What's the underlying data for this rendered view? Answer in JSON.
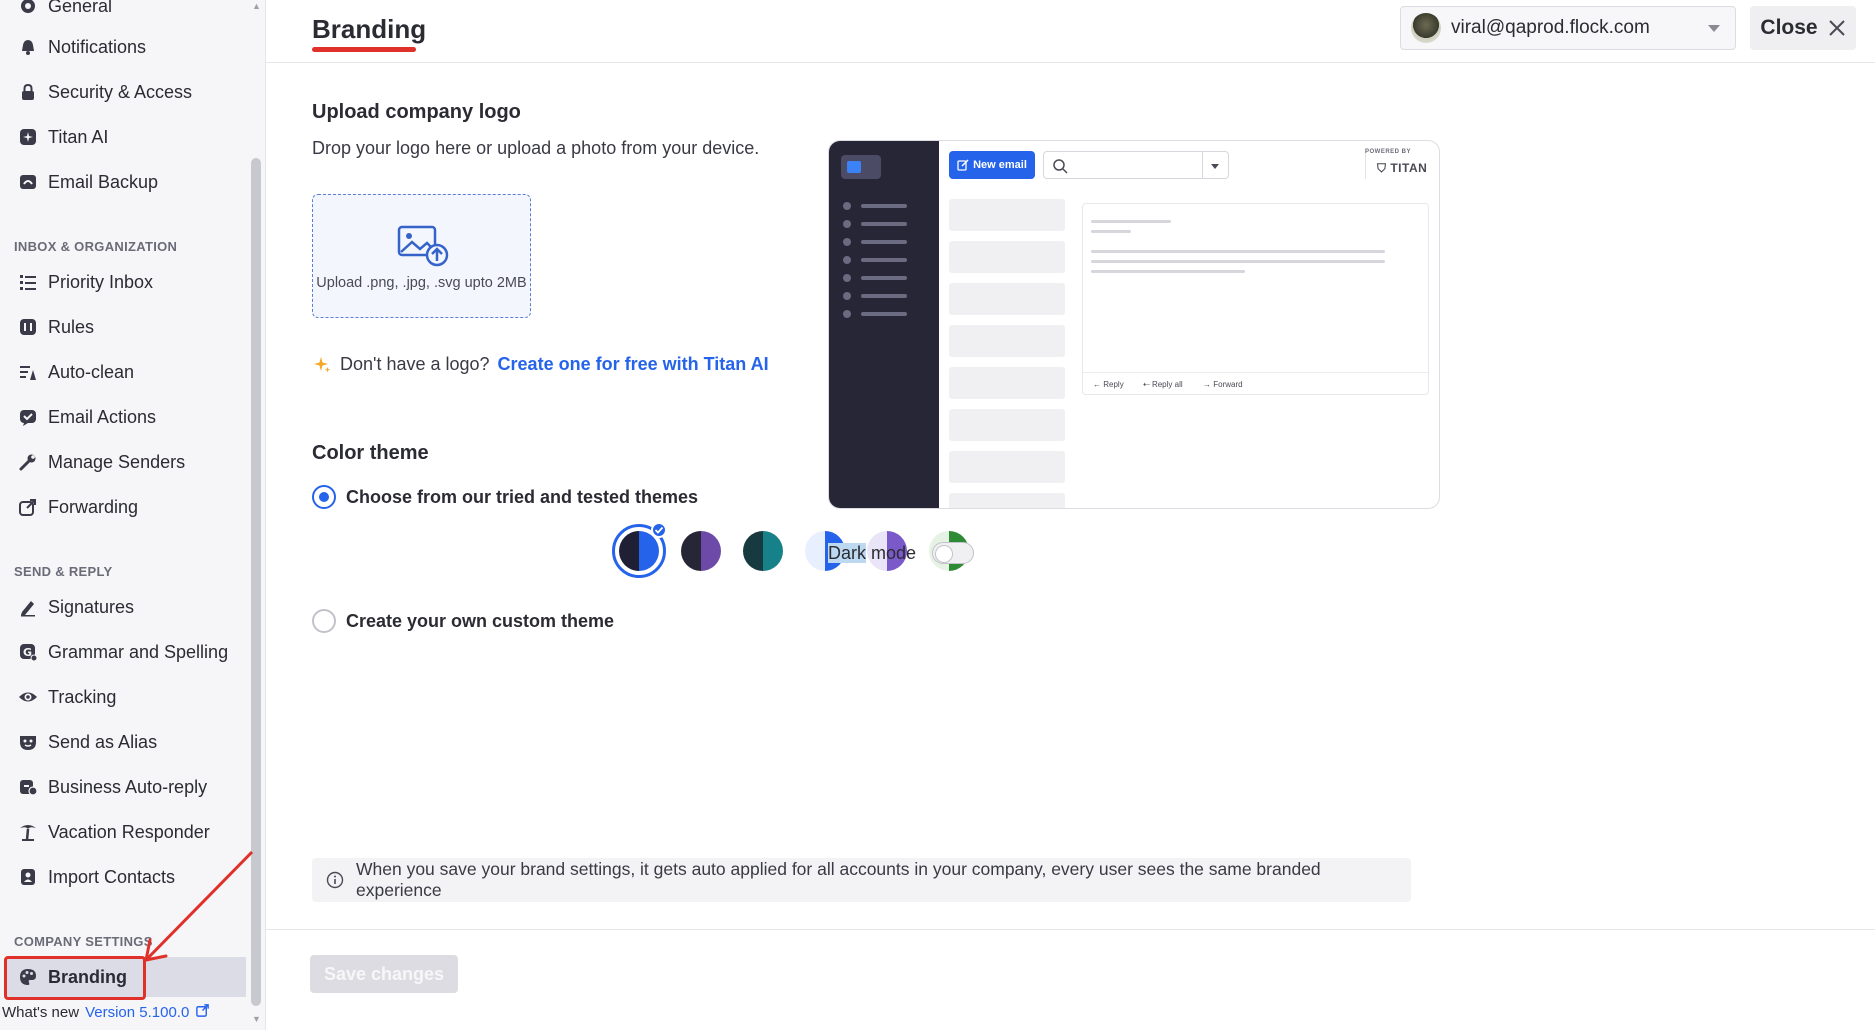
{
  "sidebar": {
    "items_top": [
      {
        "label": "General",
        "icon": "gear-icon"
      },
      {
        "label": "Notifications",
        "icon": "bell-icon"
      },
      {
        "label": "Security & Access",
        "icon": "lock-icon"
      },
      {
        "label": "Titan AI",
        "icon": "sparkle-icon"
      },
      {
        "label": "Email Backup",
        "icon": "backup-icon"
      }
    ],
    "section_inbox": "INBOX & ORGANIZATION",
    "items_inbox": [
      {
        "label": "Priority Inbox",
        "icon": "priority-list-icon"
      },
      {
        "label": "Rules",
        "icon": "rules-icon"
      },
      {
        "label": "Auto-clean",
        "icon": "auto-clean-icon"
      },
      {
        "label": "Email Actions",
        "icon": "email-actions-icon"
      },
      {
        "label": "Manage Senders",
        "icon": "wrench-icon"
      },
      {
        "label": "Forwarding",
        "icon": "forward-icon"
      }
    ],
    "section_send": "SEND & REPLY",
    "items_send": [
      {
        "label": "Signatures",
        "icon": "pen-icon"
      },
      {
        "label": "Grammar and Spelling",
        "icon": "grammar-icon"
      },
      {
        "label": "Tracking",
        "icon": "eye-icon"
      },
      {
        "label": "Send as Alias",
        "icon": "mask-icon"
      },
      {
        "label": "Business Auto-reply",
        "icon": "auto-reply-icon"
      },
      {
        "label": "Vacation Responder",
        "icon": "palm-tree-icon"
      },
      {
        "label": "Import Contacts",
        "icon": "contacts-icon"
      }
    ],
    "section_company": "COMPANY SETTINGS",
    "active_item": {
      "label": "Branding",
      "icon": "palette-icon"
    },
    "whats_new": "What's new",
    "version": "Version 5.100.0"
  },
  "header": {
    "title": "Branding",
    "account_email": "viral@qaprod.flock.com",
    "close_label": "Close"
  },
  "upload": {
    "heading": "Upload company logo",
    "subtext": "Drop your logo here or upload a photo from your device.",
    "dropzone_text": "Upload .png, .jpg, .svg upto 2MB",
    "ai_prompt": "Don't have a logo?",
    "ai_link": "Create one for free with Titan AI"
  },
  "color_theme": {
    "heading": "Color theme",
    "option_preset": "Choose from our tried and tested themes",
    "option_custom": "Create your own custom theme",
    "swatches": [
      {
        "left": "#1f1f35",
        "right": "#2563eb",
        "selected": true
      },
      {
        "left": "#262637",
        "right": "#6d4aa8",
        "selected": false
      },
      {
        "left": "#173a40",
        "right": "#17818a",
        "selected": false
      },
      {
        "left": "#e8efff",
        "right": "#2563eb",
        "selected": false
      },
      {
        "left": "#e9e4f7",
        "right": "#7a5ac8",
        "selected": false
      },
      {
        "left": "#e6f2e3",
        "right": "#2f8a36",
        "selected": false
      }
    ]
  },
  "preview": {
    "new_email": "New email",
    "powered_by": "POWERED BY",
    "brand": "TITAN",
    "reply": "Reply",
    "reply_all": "Reply all",
    "forward": "Forward"
  },
  "dark_mode": {
    "word_highlight": "Dark",
    "word_rest": "mode"
  },
  "info": "When you save your brand settings, it gets auto applied for all accounts in your company, every user sees the same branded experience",
  "save_label": "Save changes",
  "colors": {
    "accent": "#2563eb",
    "annotation": "#e0302a"
  }
}
